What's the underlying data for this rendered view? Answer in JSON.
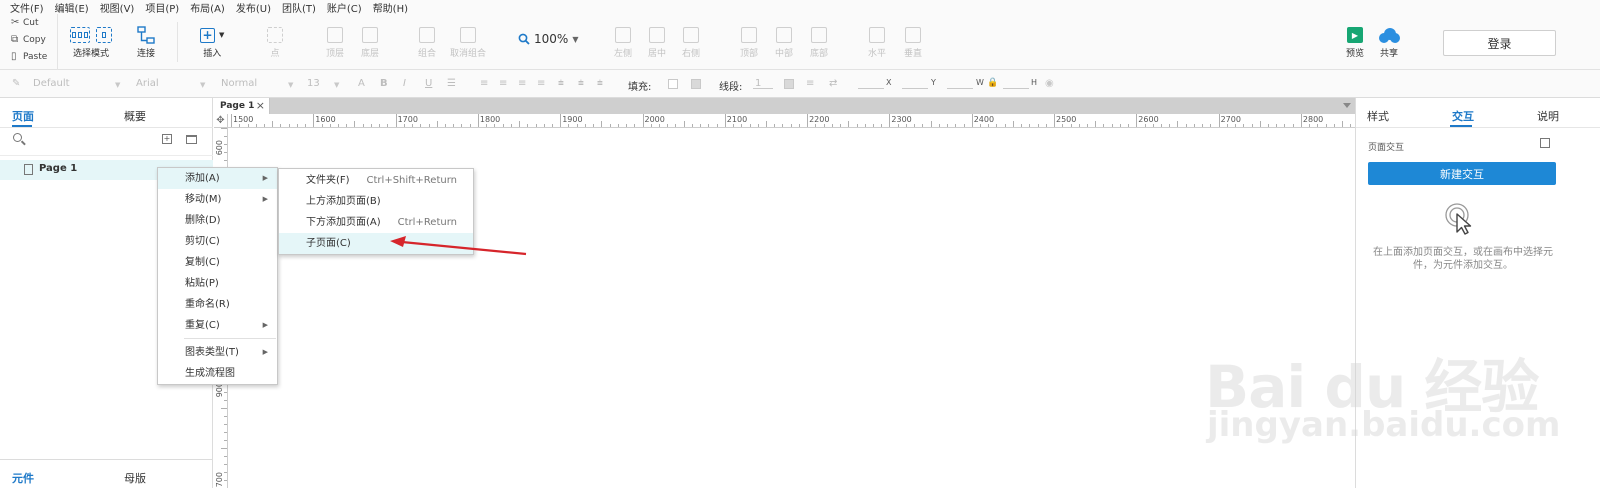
{
  "menubar": {
    "items": [
      "文件(F)",
      "编辑(E)",
      "视图(V)",
      "项目(P)",
      "布局(A)",
      "发布(U)",
      "团队(T)",
      "账户(C)",
      "帮助(H)"
    ]
  },
  "clipboard": {
    "cut": "Cut",
    "copy": "Copy",
    "paste": "Paste"
  },
  "toolbar": {
    "select_mode": "选择模式",
    "connect": "连接",
    "insert": "插入",
    "point": "点",
    "top_layer": "顶层",
    "bottom_layer": "底层",
    "group": "组合",
    "ungroup": "取消组合",
    "zoom": "100%",
    "align_left": "左侧",
    "align_center": "居中",
    "align_right": "右侧",
    "align_top": "顶部",
    "align_middle": "中部",
    "align_bottom": "底部",
    "dist_h": "水平",
    "dist_v": "垂直",
    "preview": "预览",
    "share": "共享",
    "login": "登录"
  },
  "format": {
    "style": "Default",
    "font": "Arial",
    "weight": "Normal",
    "size": "13",
    "fill_label": "填充:",
    "line_label": "线段:",
    "line_value": "1",
    "x_label": "X",
    "y_label": "Y",
    "w_label": "W",
    "h_label": "H"
  },
  "left": {
    "tab_pages": "页面",
    "tab_outline": "概要",
    "page1": "Page 1",
    "tab_widgets": "元件",
    "tab_masters": "母版"
  },
  "canvas": {
    "tab": "Page 1",
    "ruler_h": [
      "1500",
      "1600",
      "1700",
      "1800",
      "1900",
      "2000",
      "2100",
      "2200",
      "2300",
      "2400",
      "2500",
      "2600",
      "2700",
      "2800"
    ],
    "ruler_v": [
      "600",
      "900",
      "700"
    ]
  },
  "context_menu": {
    "add": "添加(A)",
    "move": "移动(M)",
    "delete": "删除(D)",
    "cut": "剪切(C)",
    "copy": "复制(C)",
    "paste": "粘贴(P)",
    "rename": "重命名(R)",
    "duplicate": "重复(C)",
    "diagram_type": "图表类型(T)",
    "flowchart": "生成流程图"
  },
  "submenu": {
    "folder": "文件夹(F)",
    "folder_shortcut": "Ctrl+Shift+Return",
    "add_above": "上方添加页面(B)",
    "add_below": "下方添加页面(A)",
    "add_below_shortcut": "Ctrl+Return",
    "child": "子页面(C)"
  },
  "right": {
    "tab_style": "样式",
    "tab_interaction": "交互",
    "tab_notes": "说明",
    "section": "页面交互",
    "new_button": "新建交互",
    "hint": "在上面添加页面交互，或在画布中选择元件，为元件添加交互。"
  },
  "watermark": {
    "brand": "Bai du 经验",
    "url": "jingyan.baidu.com"
  },
  "colors": {
    "accent": "#1e79c8",
    "button": "#1e88d6",
    "highlight": "#e5f6f8",
    "arrow": "#d6252b"
  }
}
